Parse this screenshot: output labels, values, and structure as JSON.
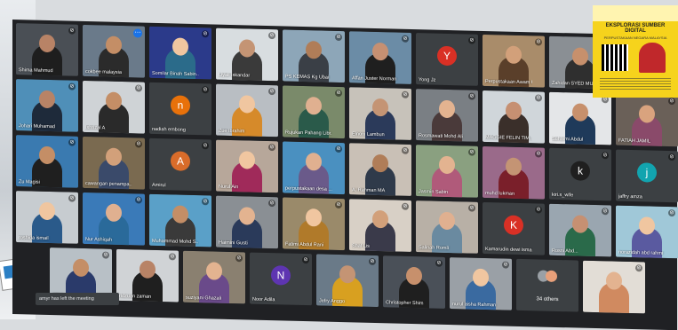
{
  "toast": "amyr has left the meeting",
  "poster": {
    "title": "EKSPLORASI SUMBER DIGITAL",
    "subtitle": "PERPUSTAKAAN NEGARA MALAYSIA"
  },
  "others_label": "34 others",
  "tiles": [
    {
      "name": "Shima Mahmud",
      "type": "cam",
      "bg": "#4a4f55",
      "person": "#1e1e1e",
      "head": "#b88366"
    },
    {
      "name": "cokbee malaysia",
      "type": "cam",
      "bg": "#6a7a8a",
      "person": "#2b2b2b",
      "head": "#c48e66",
      "more": true
    },
    {
      "name": "Somilar Binah Sabin...",
      "type": "cam",
      "bg": "#2b3a8a",
      "person": "#2b6b8a",
      "head": "#f0c6a0"
    },
    {
      "name": "Liyali Iskandar",
      "type": "cam",
      "bg": "#d8dde0",
      "person": "#3a3a3a",
      "head": "#c49474"
    },
    {
      "name": "PS KEMAS Kg Ubai",
      "type": "cam",
      "bg": "#8da6b8",
      "person": "#3a3f46",
      "head": "#b07d58"
    },
    {
      "name": "Affan Juster Norman",
      "type": "cam",
      "bg": "#6b8ca6",
      "person": "#1f1f1f",
      "head": "#c69072"
    },
    {
      "name": "Yong Jz",
      "type": "avatar",
      "letter": "Y",
      "color": "#d93025"
    },
    {
      "name": "Perpustakaan Awam Ulu...",
      "type": "cam",
      "bg": "#a98c6a",
      "person": "#5a3f2a",
      "head": "#d2a07a"
    },
    {
      "name": "Zahidan SYED MUH...",
      "type": "cam",
      "bg": "#8a8f94",
      "person": "#2f2f2f",
      "head": "#c7906c"
    },
    {
      "name": "Johari Muhamad",
      "type": "cam",
      "bg": "#4f8fb8",
      "person": "#1e2a3a",
      "head": "#b88366"
    },
    {
      "name": "Ishrizal A",
      "type": "cam",
      "bg": "#cfd3d6",
      "person": "#2a2a2a",
      "head": "#c48e66"
    },
    {
      "name": "nadiah embong",
      "type": "avatar",
      "letter": "n",
      "color": "#e8710a"
    },
    {
      "name": "Zue Ibrahim",
      "type": "cam",
      "bg": "#b9bec3",
      "person": "#d68a2a",
      "head": "#f0c6a0"
    },
    {
      "name": "Rujukan Pahang Libr...",
      "type": "cam",
      "bg": "#7a8a6a",
      "person": "#2a5a4a",
      "head": "#e0b090"
    },
    {
      "name": "Elnoni Lambun",
      "type": "cam",
      "bg": "#c7c2ba",
      "person": "#2b3a5a",
      "head": "#c49474"
    },
    {
      "name": "Rosmawati Mohd Ali",
      "type": "cam",
      "bg": "#7a7f84",
      "person": "#4a3a3a",
      "head": "#e3b390"
    },
    {
      "name": "MAGGIE FELIN TIM...",
      "type": "cam",
      "bg": "#d0d6da",
      "person": "#3a2f2a",
      "head": "#c69072"
    },
    {
      "name": "Suhaimi Abdul",
      "type": "cam",
      "bg": "#e4e6e8",
      "person": "#1f3a5a",
      "head": "#c7906c"
    },
    {
      "name": "FATIAH JAMIL",
      "type": "cam",
      "bg": "#6a6058",
      "person": "#8a4a6a",
      "head": "#d9a37e"
    },
    {
      "name": "Zu Magisi",
      "type": "cam",
      "bg": "#3a7ab0",
      "person": "#1f1f1f",
      "head": "#c48e66"
    },
    {
      "name": "cawangan penampa...",
      "type": "cam",
      "bg": "#7a6a50",
      "person": "#3a4a6a",
      "head": "#d2a07a"
    },
    {
      "name": "Amirul",
      "type": "avatar",
      "letter": "A",
      "color": "#d96c2a"
    },
    {
      "name": "Nurul Ain",
      "type": "cam",
      "bg": "#b7a79a",
      "person": "#a02a5a",
      "head": "#f0c6a0"
    },
    {
      "name": "perpustakaan desa ...",
      "type": "cam",
      "bg": "#4a90c0",
      "person": "#6a5a8a",
      "head": "#e0b090"
    },
    {
      "name": "A. Rahman MA",
      "type": "cam",
      "bg": "#c9c0b6",
      "person": "#2f3a4a",
      "head": "#b07d58"
    },
    {
      "name": "Jasmin Sabin",
      "type": "cam",
      "bg": "#8aa080",
      "person": "#b05a7a",
      "head": "#e3b390"
    },
    {
      "name": "muhd lukman",
      "type": "cam",
      "bg": "#9a6a8a",
      "person": "#7a1f2a",
      "head": "#c49474"
    },
    {
      "name": "kiri.s_wife",
      "type": "avatar",
      "letter": "k",
      "color": "#1f1f1f"
    },
    {
      "name": "jaffry amza",
      "type": "avatar",
      "letter": "j",
      "color": "#12a4af"
    },
    {
      "name": "roshida ismail",
      "type": "cam",
      "bg": "#c7ccd0",
      "person": "#2a5a8a",
      "head": "#f0c6a0"
    },
    {
      "name": "Nur Ashiqah",
      "type": "cam",
      "bg": "#3a7ab8",
      "person": "#2a6a9a",
      "head": "#e0b090"
    },
    {
      "name": "Muhammad Mohd S...",
      "type": "cam",
      "bg": "#5aa0c8",
      "person": "#3a3a3a",
      "head": "#c48e66"
    },
    {
      "name": "Haimini Gusti",
      "type": "cam",
      "bg": "#8a8f94",
      "person": "#2a3a5a",
      "head": "#e3b390"
    },
    {
      "name": "Fatimi Abdul Rani",
      "type": "cam",
      "bg": "#9a8a6a",
      "person": "#b07a2a",
      "head": "#f0c6a0"
    },
    {
      "name": "Shaf Lis",
      "type": "cam",
      "bg": "#d8d0c6",
      "person": "#3a3a4a",
      "head": "#d2a07a"
    },
    {
      "name": "Salinah Romli",
      "type": "cam",
      "bg": "#b8b0a6",
      "person": "#6a8aa0",
      "head": "#e0b090"
    },
    {
      "name": "Kamarudin dewi ismail",
      "type": "avatar",
      "letter": "K",
      "color": "#d93025"
    },
    {
      "name": "Rosni Abd...",
      "type": "cam",
      "bg": "#9aa6b0",
      "person": "#2a6a4a",
      "head": "#c69072"
    },
    {
      "name": "norazidah abd rahmi",
      "type": "cam",
      "bg": "#a0c8d8",
      "person": "#5a5aa0",
      "head": "#f0c6a0"
    },
    {
      "name": "amyr",
      "type": "cam",
      "bg": "#b8c0c6",
      "person": "#2a3a6a",
      "head": "#c48e66"
    },
    {
      "name": "ridzuan zaman",
      "type": "cam",
      "bg": "#d0d3d6",
      "person": "#1f1f1f",
      "head": "#b88366"
    },
    {
      "name": "suziyani Ghazali",
      "type": "cam",
      "bg": "#8a8070",
      "person": "#6a4a8a",
      "head": "#e3b390"
    },
    {
      "name": "Noor Adila",
      "type": "avatar",
      "letter": "N",
      "color": "#5e35b1"
    },
    {
      "name": "Jefry Anggo",
      "type": "cam",
      "bg": "#6a7a88",
      "person": "#d8a020",
      "head": "#c49474"
    },
    {
      "name": "Christopher Shim",
      "type": "cam",
      "bg": "#4a5058",
      "person": "#1f1f1f",
      "head": "#c7906c"
    },
    {
      "name": "nurul aisha Rahman",
      "type": "cam",
      "bg": "#9aa0a6",
      "person": "#3a6aa0",
      "head": "#f0c6a0"
    },
    {
      "name": "others",
      "type": "others"
    },
    {
      "name": "",
      "type": "cam",
      "bg": "#e2ddd6",
      "person": "#d08a60",
      "head": "#e3b390"
    }
  ]
}
